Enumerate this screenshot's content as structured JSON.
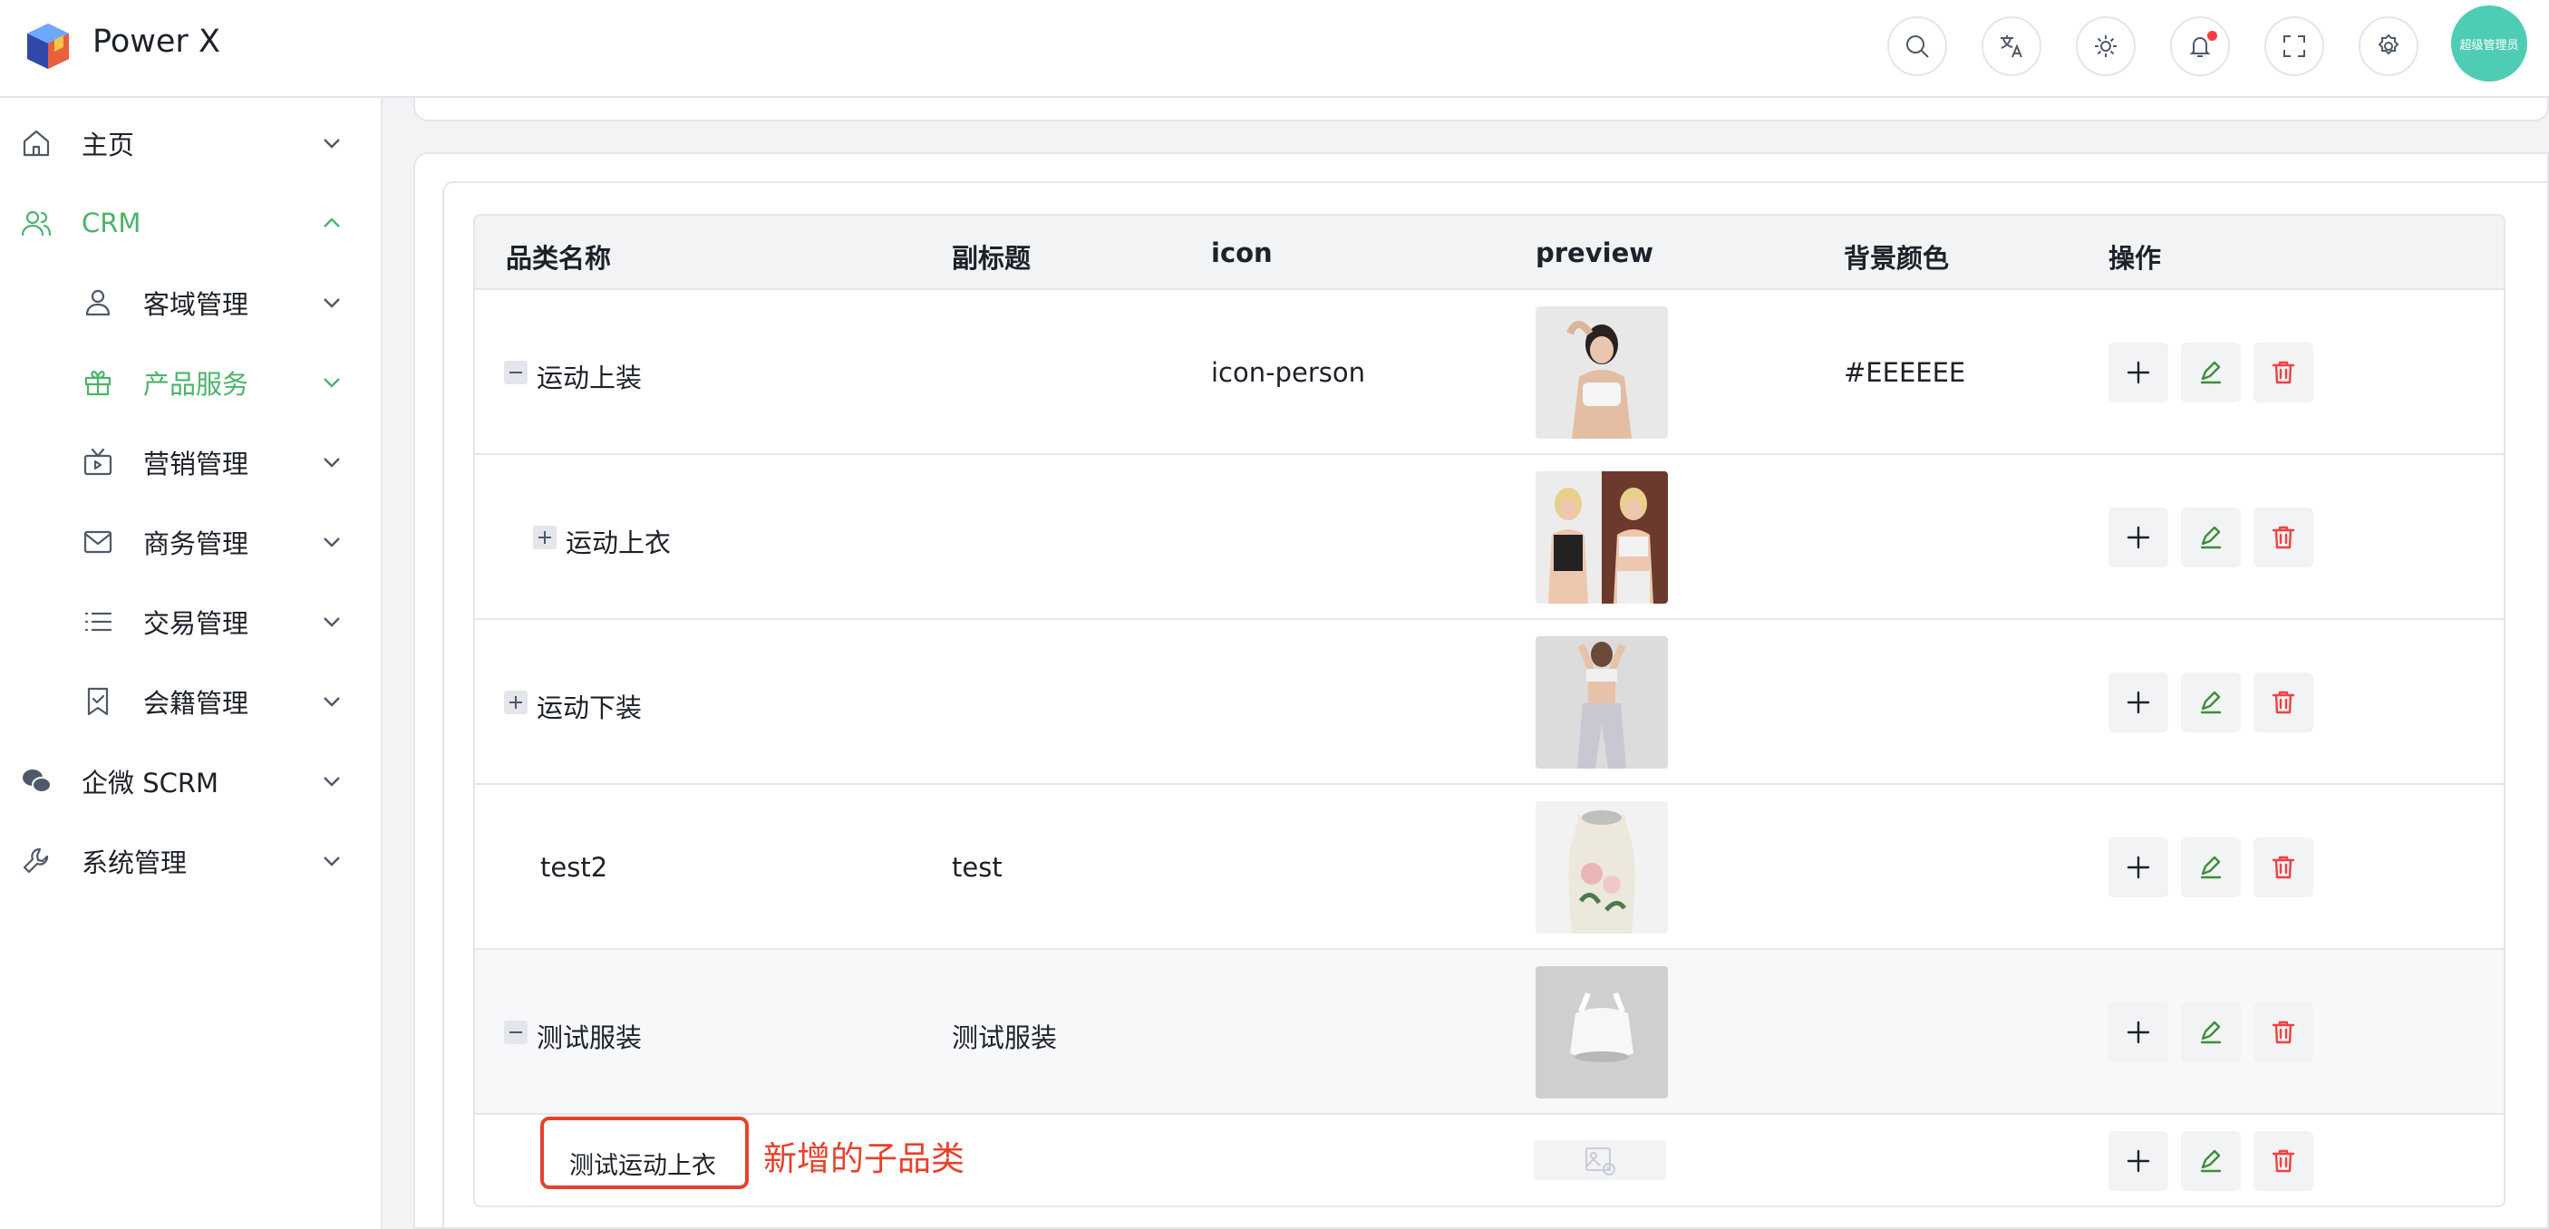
{
  "app": {
    "title": "Power X",
    "avatar_text": "超级管理员"
  },
  "sidebar": {
    "items": [
      {
        "label": "主页",
        "icon": "home-icon"
      },
      {
        "label": "CRM",
        "icon": "users-icon",
        "active": true,
        "expanded": true
      },
      {
        "label": "客域管理",
        "icon": "user-icon"
      },
      {
        "label": "产品服务",
        "icon": "gift-icon",
        "active": true
      },
      {
        "label": "营销管理",
        "icon": "tv-icon"
      },
      {
        "label": "商务管理",
        "icon": "mail-icon"
      },
      {
        "label": "交易管理",
        "icon": "list-icon"
      },
      {
        "label": "会籍管理",
        "icon": "bookmark-check-icon"
      },
      {
        "label": "企微 SCRM",
        "icon": "wechat-icon"
      },
      {
        "label": "系统管理",
        "icon": "wrench-icon"
      }
    ]
  },
  "table": {
    "columns": [
      "品类名称",
      "副标题",
      "icon",
      "preview",
      "背景颜色",
      "操作"
    ],
    "rows": [
      {
        "name": "运动上装",
        "subtitle": "",
        "icon": "icon-person",
        "bg": "#EEEEEE",
        "toggle": "minus"
      },
      {
        "name": "运动上衣",
        "subtitle": "",
        "icon": "",
        "bg": "",
        "toggle": "plus"
      },
      {
        "name": "运动下装",
        "subtitle": "",
        "icon": "",
        "bg": "",
        "toggle": "plus"
      },
      {
        "name": "test2",
        "subtitle": "test",
        "icon": "",
        "bg": "",
        "toggle": "none"
      },
      {
        "name": "测试服装",
        "subtitle": "测试服装",
        "icon": "",
        "bg": "",
        "toggle": "minus"
      },
      {
        "name": "测试运动上衣",
        "subtitle": "",
        "icon": "",
        "bg": "",
        "toggle": "none"
      }
    ]
  },
  "annotation": {
    "text": "新增的子品类",
    "color": "#e8412c"
  },
  "colors": {
    "accent": "#4cb36a",
    "danger": "#f53f3f",
    "edit": "#3a8f3a"
  }
}
